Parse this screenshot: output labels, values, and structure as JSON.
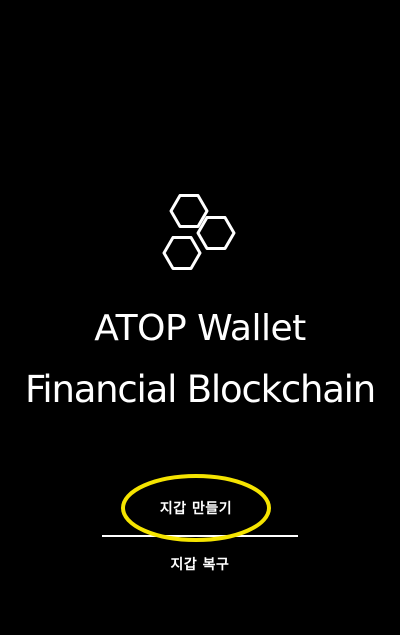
{
  "app": {
    "title_line1": "ATOP Wallet",
    "title_line2": "Financial Blockchain",
    "logo_icon": "hexagon-cluster-icon"
  },
  "actions": {
    "create_wallet_label": "지갑 만들기",
    "restore_wallet_label": "지갑 복구"
  },
  "colors": {
    "background": "#000000",
    "text": "#ffffff",
    "highlight": "#f5e400"
  }
}
